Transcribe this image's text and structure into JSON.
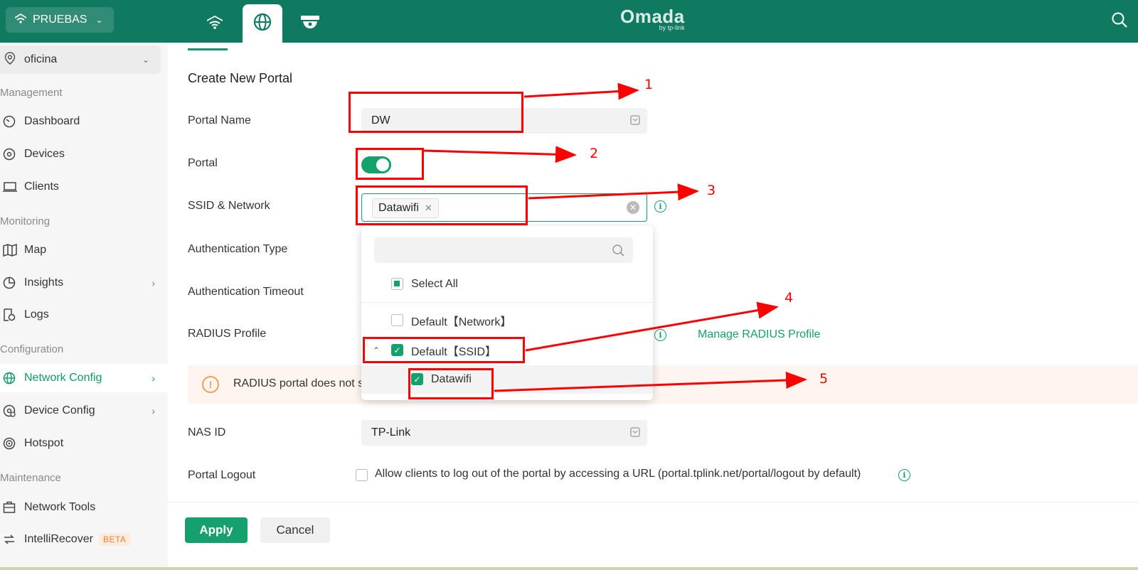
{
  "header": {
    "site_name": "PRUEBAS",
    "brand_logo": "Omada",
    "brand_sub": "by tp-link"
  },
  "sidebar": {
    "site_select": "oficina",
    "sections": {
      "management": "Management",
      "monitoring": "Monitoring",
      "configuration": "Configuration",
      "maintenance": "Maintenance"
    },
    "items": {
      "dashboard": "Dashboard",
      "devices": "Devices",
      "clients": "Clients",
      "map": "Map",
      "insights": "Insights",
      "logs": "Logs",
      "network_config": "Network Config",
      "device_config": "Device Config",
      "hotspot": "Hotspot",
      "network_tools": "Network Tools",
      "intellirecover": "IntelliRecover",
      "beta_badge": "BETA"
    }
  },
  "form": {
    "title": "Create New Portal",
    "portal_name_label": "Portal Name",
    "portal_name_value": "DW",
    "portal_label": "Portal",
    "portal_enabled": true,
    "ssid_label": "SSID & Network",
    "ssid_chip": "Datawifi",
    "auth_type_label": "Authentication Type",
    "auth_timeout_label": "Authentication Timeout",
    "radius_label": "RADIUS Profile",
    "manage_radius_link": "Manage RADIUS Profile",
    "warning_text": "RADIUS portal does not s",
    "nas_id_label": "NAS ID",
    "nas_id_value": "TP-Link",
    "logout_label": "Portal Logout",
    "logout_text": "Allow clients to log out of the portal by accessing a URL (portal.tplink.net/portal/logout by default)",
    "apply_label": "Apply",
    "cancel_label": "Cancel"
  },
  "dropdown": {
    "select_all": "Select All",
    "option_network": "Default【Network】",
    "option_ssid": "Default【SSID】",
    "sub_option": "Datawifi"
  },
  "annotations": [
    "1",
    "2",
    "3",
    "4",
    "5"
  ],
  "colors": {
    "topbar": "#0f7a5f",
    "accent": "#16a06d",
    "annotation": "#ff0000",
    "warning": "#f0a050"
  }
}
